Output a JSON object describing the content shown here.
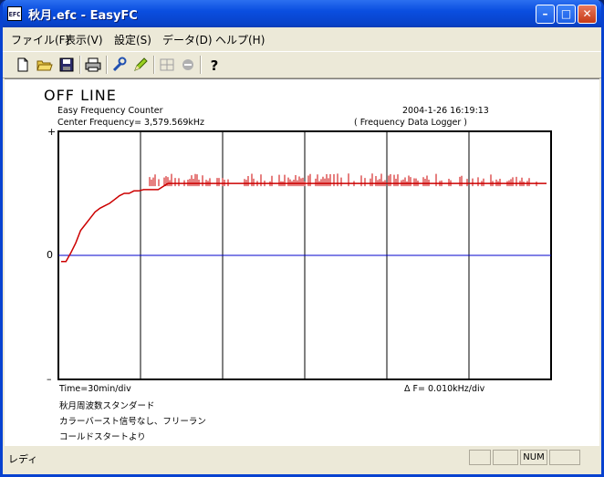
{
  "window": {
    "title": "秋月.efc - EasyFC",
    "app_icon_label": "EFC"
  },
  "titlebar": {
    "minimize": "–",
    "maximize": "□",
    "close": "✕"
  },
  "menu": {
    "items": [
      "ファイル(F)",
      "表示(V)",
      "設定(S)",
      "データ(D)",
      "ヘルプ(H)"
    ]
  },
  "toolbar": {
    "icons": [
      "new-file-icon",
      "open-folder-icon",
      "save-icon",
      "print-icon",
      "wrench-icon",
      "pen-icon",
      "grid-icon",
      "stop-icon",
      "help-icon"
    ]
  },
  "header": {
    "status": "OFF LINE",
    "app_name": "Easy Frequency Counter",
    "center_frequency": "Center Frequency= 3,579.569kHz",
    "datetime": "2004-1-26  16:19:13",
    "mode": "( Frequency Data Logger )"
  },
  "chart_data": {
    "type": "line",
    "y_tick_labels": [
      "+",
      "0",
      "–"
    ],
    "x_label": "Time=30min/div",
    "y_scale_label": "Δ F=    0.010kHz/div",
    "grid": true,
    "x_divisions": 6,
    "y_divisions": 2,
    "series_color": "#cc0000",
    "axis_color": "#0000cc",
    "series": [
      {
        "x": [
          0.0,
          0.01,
          0.02,
          0.03,
          0.04,
          0.05,
          0.06,
          0.07,
          0.08,
          0.09,
          0.1,
          0.11,
          0.12,
          0.13,
          0.14,
          0.15,
          0.16,
          0.17,
          0.18,
          0.19,
          0.2,
          0.22,
          0.25,
          0.3,
          0.35,
          0.4,
          0.45,
          0.5,
          0.55,
          0.6,
          0.65,
          0.7,
          0.75,
          0.8,
          0.85,
          0.9,
          0.95,
          1.0
        ],
        "y": [
          -0.05,
          -0.05,
          0.02,
          0.1,
          0.2,
          0.25,
          0.3,
          0.35,
          0.38,
          0.4,
          0.42,
          0.45,
          0.48,
          0.5,
          0.5,
          0.52,
          0.52,
          0.53,
          0.53,
          0.53,
          0.53,
          0.58,
          0.58,
          0.58,
          0.58,
          0.58,
          0.58,
          0.58,
          0.58,
          0.58,
          0.58,
          0.58,
          0.58,
          0.58,
          0.58,
          0.58,
          0.58,
          0.58
        ]
      }
    ]
  },
  "notes": {
    "line1": "秋月周波数スタンダード",
    "line2": "カラーバースト信号なし、フリーラン",
    "line3": "コールドスタートより"
  },
  "statusbar": {
    "text": "レディ",
    "num": "NUM"
  }
}
